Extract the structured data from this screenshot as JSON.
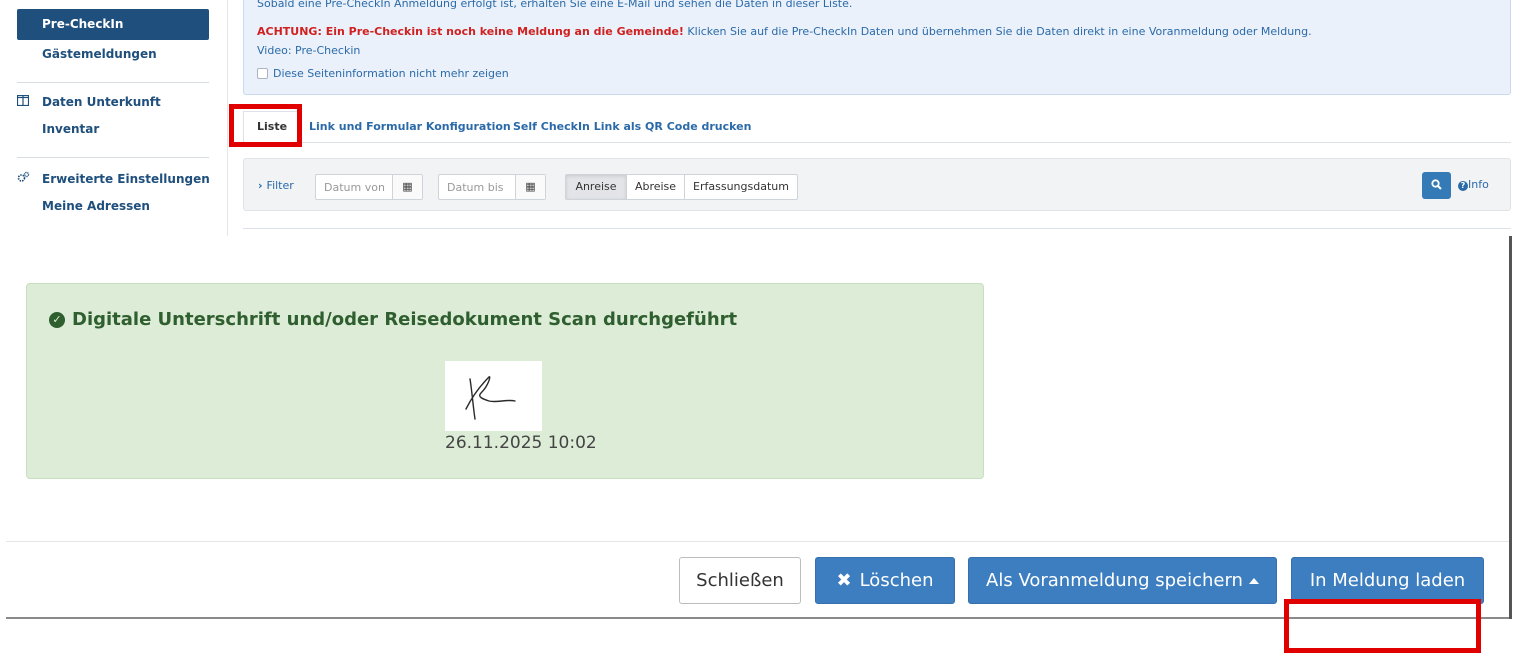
{
  "sidebar": {
    "active_item": "Pre-CheckIn",
    "items": [
      {
        "label": "Gästemeldungen"
      },
      {
        "label": "Daten Unterkunft",
        "icon": "columns-icon"
      },
      {
        "label": "Inventar"
      },
      {
        "label": "Erweiterte Einstellungen",
        "icon": "cogs-icon"
      },
      {
        "label": "Meine Adressen"
      }
    ]
  },
  "info_box": {
    "line1": "Sobald eine Pre-CheckIn Anmeldung erfolgt ist, erhalten Sie eine E-Mail und sehen die Daten in dieser Liste.",
    "warning": "ACHTUNG: Ein Pre-Checkin ist noch keine Meldung an die Gemeinde!",
    "line2": " Klicken Sie auf die Pre-CheckIn Daten und übernehmen Sie die Daten direkt in eine Voranmeldung oder Meldung.",
    "video_link": "Video: Pre-Checkin",
    "hide_checkbox_label": "Diese Seiteninformation nicht mehr zeigen"
  },
  "tabs": [
    {
      "label": "Liste"
    },
    {
      "label": "Link und Formular Konfiguration"
    },
    {
      "label": "Self CheckIn Link als QR Code drucken"
    }
  ],
  "filter": {
    "label": "Filter",
    "date_from_placeholder": "Datum von",
    "date_to_placeholder": "Datum bis",
    "segments": [
      "Anreise",
      "Abreise",
      "Erfassungsdatum"
    ],
    "active_segment": "Anreise",
    "info_label": "Info"
  },
  "modal": {
    "success_title": "Digitale Unterschrift und/oder Reisedokument Scan durchgeführt",
    "signature_timestamp": "26.11.2025 10:02",
    "buttons": {
      "close": "Schließen",
      "delete": "Löschen",
      "save_as_preregistration": "Als Voranmeldung speichern",
      "load_into_registration": "In Meldung laden"
    }
  },
  "colors": {
    "brand": "#1f4f7c",
    "primary_button": "#3d7ec0",
    "success_bg": "#dcecd7",
    "warning_text": "#d0201f",
    "highlight": "#e00000"
  }
}
